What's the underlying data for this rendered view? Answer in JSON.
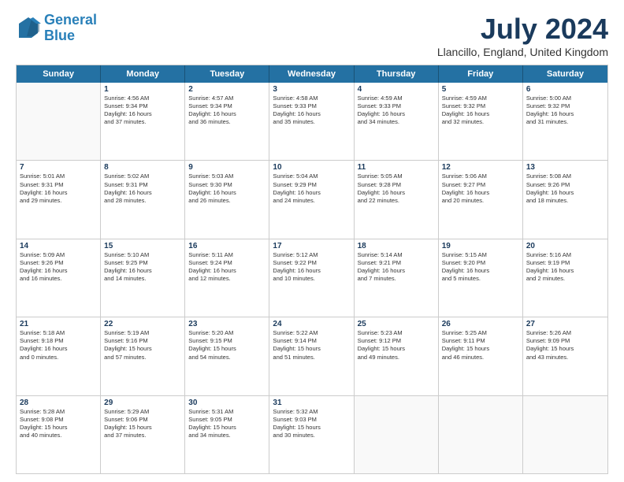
{
  "header": {
    "logo_line1": "General",
    "logo_line2": "Blue",
    "title": "July 2024",
    "location": "Llancillo, England, United Kingdom"
  },
  "weekdays": [
    "Sunday",
    "Monday",
    "Tuesday",
    "Wednesday",
    "Thursday",
    "Friday",
    "Saturday"
  ],
  "rows": [
    [
      {
        "day": "",
        "lines": []
      },
      {
        "day": "1",
        "lines": [
          "Sunrise: 4:56 AM",
          "Sunset: 9:34 PM",
          "Daylight: 16 hours",
          "and 37 minutes."
        ]
      },
      {
        "day": "2",
        "lines": [
          "Sunrise: 4:57 AM",
          "Sunset: 9:34 PM",
          "Daylight: 16 hours",
          "and 36 minutes."
        ]
      },
      {
        "day": "3",
        "lines": [
          "Sunrise: 4:58 AM",
          "Sunset: 9:33 PM",
          "Daylight: 16 hours",
          "and 35 minutes."
        ]
      },
      {
        "day": "4",
        "lines": [
          "Sunrise: 4:59 AM",
          "Sunset: 9:33 PM",
          "Daylight: 16 hours",
          "and 34 minutes."
        ]
      },
      {
        "day": "5",
        "lines": [
          "Sunrise: 4:59 AM",
          "Sunset: 9:32 PM",
          "Daylight: 16 hours",
          "and 32 minutes."
        ]
      },
      {
        "day": "6",
        "lines": [
          "Sunrise: 5:00 AM",
          "Sunset: 9:32 PM",
          "Daylight: 16 hours",
          "and 31 minutes."
        ]
      }
    ],
    [
      {
        "day": "7",
        "lines": [
          "Sunrise: 5:01 AM",
          "Sunset: 9:31 PM",
          "Daylight: 16 hours",
          "and 29 minutes."
        ]
      },
      {
        "day": "8",
        "lines": [
          "Sunrise: 5:02 AM",
          "Sunset: 9:31 PM",
          "Daylight: 16 hours",
          "and 28 minutes."
        ]
      },
      {
        "day": "9",
        "lines": [
          "Sunrise: 5:03 AM",
          "Sunset: 9:30 PM",
          "Daylight: 16 hours",
          "and 26 minutes."
        ]
      },
      {
        "day": "10",
        "lines": [
          "Sunrise: 5:04 AM",
          "Sunset: 9:29 PM",
          "Daylight: 16 hours",
          "and 24 minutes."
        ]
      },
      {
        "day": "11",
        "lines": [
          "Sunrise: 5:05 AM",
          "Sunset: 9:28 PM",
          "Daylight: 16 hours",
          "and 22 minutes."
        ]
      },
      {
        "day": "12",
        "lines": [
          "Sunrise: 5:06 AM",
          "Sunset: 9:27 PM",
          "Daylight: 16 hours",
          "and 20 minutes."
        ]
      },
      {
        "day": "13",
        "lines": [
          "Sunrise: 5:08 AM",
          "Sunset: 9:26 PM",
          "Daylight: 16 hours",
          "and 18 minutes."
        ]
      }
    ],
    [
      {
        "day": "14",
        "lines": [
          "Sunrise: 5:09 AM",
          "Sunset: 9:26 PM",
          "Daylight: 16 hours",
          "and 16 minutes."
        ]
      },
      {
        "day": "15",
        "lines": [
          "Sunrise: 5:10 AM",
          "Sunset: 9:25 PM",
          "Daylight: 16 hours",
          "and 14 minutes."
        ]
      },
      {
        "day": "16",
        "lines": [
          "Sunrise: 5:11 AM",
          "Sunset: 9:24 PM",
          "Daylight: 16 hours",
          "and 12 minutes."
        ]
      },
      {
        "day": "17",
        "lines": [
          "Sunrise: 5:12 AM",
          "Sunset: 9:22 PM",
          "Daylight: 16 hours",
          "and 10 minutes."
        ]
      },
      {
        "day": "18",
        "lines": [
          "Sunrise: 5:14 AM",
          "Sunset: 9:21 PM",
          "Daylight: 16 hours",
          "and 7 minutes."
        ]
      },
      {
        "day": "19",
        "lines": [
          "Sunrise: 5:15 AM",
          "Sunset: 9:20 PM",
          "Daylight: 16 hours",
          "and 5 minutes."
        ]
      },
      {
        "day": "20",
        "lines": [
          "Sunrise: 5:16 AM",
          "Sunset: 9:19 PM",
          "Daylight: 16 hours",
          "and 2 minutes."
        ]
      }
    ],
    [
      {
        "day": "21",
        "lines": [
          "Sunrise: 5:18 AM",
          "Sunset: 9:18 PM",
          "Daylight: 16 hours",
          "and 0 minutes."
        ]
      },
      {
        "day": "22",
        "lines": [
          "Sunrise: 5:19 AM",
          "Sunset: 9:16 PM",
          "Daylight: 15 hours",
          "and 57 minutes."
        ]
      },
      {
        "day": "23",
        "lines": [
          "Sunrise: 5:20 AM",
          "Sunset: 9:15 PM",
          "Daylight: 15 hours",
          "and 54 minutes."
        ]
      },
      {
        "day": "24",
        "lines": [
          "Sunrise: 5:22 AM",
          "Sunset: 9:14 PM",
          "Daylight: 15 hours",
          "and 51 minutes."
        ]
      },
      {
        "day": "25",
        "lines": [
          "Sunrise: 5:23 AM",
          "Sunset: 9:12 PM",
          "Daylight: 15 hours",
          "and 49 minutes."
        ]
      },
      {
        "day": "26",
        "lines": [
          "Sunrise: 5:25 AM",
          "Sunset: 9:11 PM",
          "Daylight: 15 hours",
          "and 46 minutes."
        ]
      },
      {
        "day": "27",
        "lines": [
          "Sunrise: 5:26 AM",
          "Sunset: 9:09 PM",
          "Daylight: 15 hours",
          "and 43 minutes."
        ]
      }
    ],
    [
      {
        "day": "28",
        "lines": [
          "Sunrise: 5:28 AM",
          "Sunset: 9:08 PM",
          "Daylight: 15 hours",
          "and 40 minutes."
        ]
      },
      {
        "day": "29",
        "lines": [
          "Sunrise: 5:29 AM",
          "Sunset: 9:06 PM",
          "Daylight: 15 hours",
          "and 37 minutes."
        ]
      },
      {
        "day": "30",
        "lines": [
          "Sunrise: 5:31 AM",
          "Sunset: 9:05 PM",
          "Daylight: 15 hours",
          "and 34 minutes."
        ]
      },
      {
        "day": "31",
        "lines": [
          "Sunrise: 5:32 AM",
          "Sunset: 9:03 PM",
          "Daylight: 15 hours",
          "and 30 minutes."
        ]
      },
      {
        "day": "",
        "lines": []
      },
      {
        "day": "",
        "lines": []
      },
      {
        "day": "",
        "lines": []
      }
    ]
  ]
}
